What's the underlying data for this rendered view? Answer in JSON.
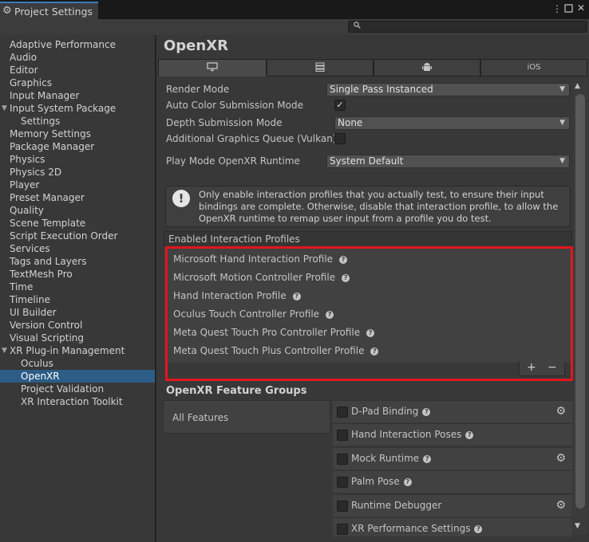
{
  "window": {
    "title": "Project Settings",
    "icons": [
      "gear-icon",
      "kebab-menu-icon",
      "maximize-icon",
      "close-icon"
    ]
  },
  "search": {
    "placeholder": ""
  },
  "sidebar": {
    "items": [
      {
        "label": "Adaptive Performance"
      },
      {
        "label": "Audio"
      },
      {
        "label": "Editor"
      },
      {
        "label": "Graphics"
      },
      {
        "label": "Input Manager"
      },
      {
        "label": "Input System Package"
      },
      {
        "label": "Settings"
      },
      {
        "label": "Memory Settings"
      },
      {
        "label": "Package Manager"
      },
      {
        "label": "Physics"
      },
      {
        "label": "Physics 2D"
      },
      {
        "label": "Player"
      },
      {
        "label": "Preset Manager"
      },
      {
        "label": "Quality"
      },
      {
        "label": "Scene Template"
      },
      {
        "label": "Script Execution Order"
      },
      {
        "label": "Services"
      },
      {
        "label": "Tags and Layers"
      },
      {
        "label": "TextMesh Pro"
      },
      {
        "label": "Time"
      },
      {
        "label": "Timeline"
      },
      {
        "label": "UI Builder"
      },
      {
        "label": "Version Control"
      },
      {
        "label": "Visual Scripting"
      },
      {
        "label": "XR Plug-in Management"
      },
      {
        "label": "Oculus"
      },
      {
        "label": "OpenXR"
      },
      {
        "label": "Project Validation"
      },
      {
        "label": "XR Interaction Toolkit"
      }
    ],
    "selected": "OpenXR"
  },
  "main": {
    "title": "OpenXR",
    "platform_tabs": [
      {
        "icon": "desktop-icon",
        "label": ""
      },
      {
        "icon": "server-icon",
        "label": ""
      },
      {
        "icon": "android-icon",
        "label": ""
      },
      {
        "icon": "",
        "label": "iOS"
      }
    ],
    "settings": {
      "render_mode_label": "Render Mode",
      "render_mode_value": "Single Pass Instanced",
      "auto_color_label": "Auto Color Submission Mode",
      "auto_color_checked": true,
      "depth_label": "Depth Submission Mode",
      "depth_value": "None",
      "graphics_queue_label": "Additional Graphics Queue (Vulkan)",
      "graphics_queue_checked": false,
      "play_mode_label": "Play Mode OpenXR Runtime",
      "play_mode_value": "System Default"
    },
    "help_text": "Only enable interaction profiles that you actually test, to ensure their input bindings are complete. Otherwise, disable that interaction profile, to allow the OpenXR runtime to remap user input from a profile you do test.",
    "profiles_header": "Enabled Interaction Profiles",
    "profiles": [
      {
        "label": "Microsoft Hand Interaction Profile"
      },
      {
        "label": "Microsoft Motion Controller Profile"
      },
      {
        "label": "Hand Interaction Profile"
      },
      {
        "label": "Oculus Touch Controller Profile"
      },
      {
        "label": "Meta Quest Touch Pro Controller Profile"
      },
      {
        "label": "Meta Quest Touch Plus Controller Profile"
      }
    ],
    "list_buttons": {
      "add": "+",
      "remove": "−"
    },
    "feature_groups_title": "OpenXR Feature Groups",
    "feature_group_all": "All Features",
    "features": [
      {
        "label": "D-Pad Binding",
        "checked": false,
        "has_settings": true
      },
      {
        "label": "Hand Interaction Poses",
        "checked": false,
        "has_settings": false
      },
      {
        "label": "Mock Runtime",
        "checked": false,
        "has_settings": true
      },
      {
        "label": "Palm Pose",
        "checked": false,
        "has_settings": false
      },
      {
        "label": "Runtime Debugger",
        "checked": false,
        "has_settings": true
      },
      {
        "label": "XR Performance Settings",
        "checked": false,
        "has_settings": false
      }
    ]
  },
  "colors": {
    "accent_tab": "#3a79bb",
    "selection": "#2c5d87",
    "highlight_outline": "#e1161c"
  }
}
